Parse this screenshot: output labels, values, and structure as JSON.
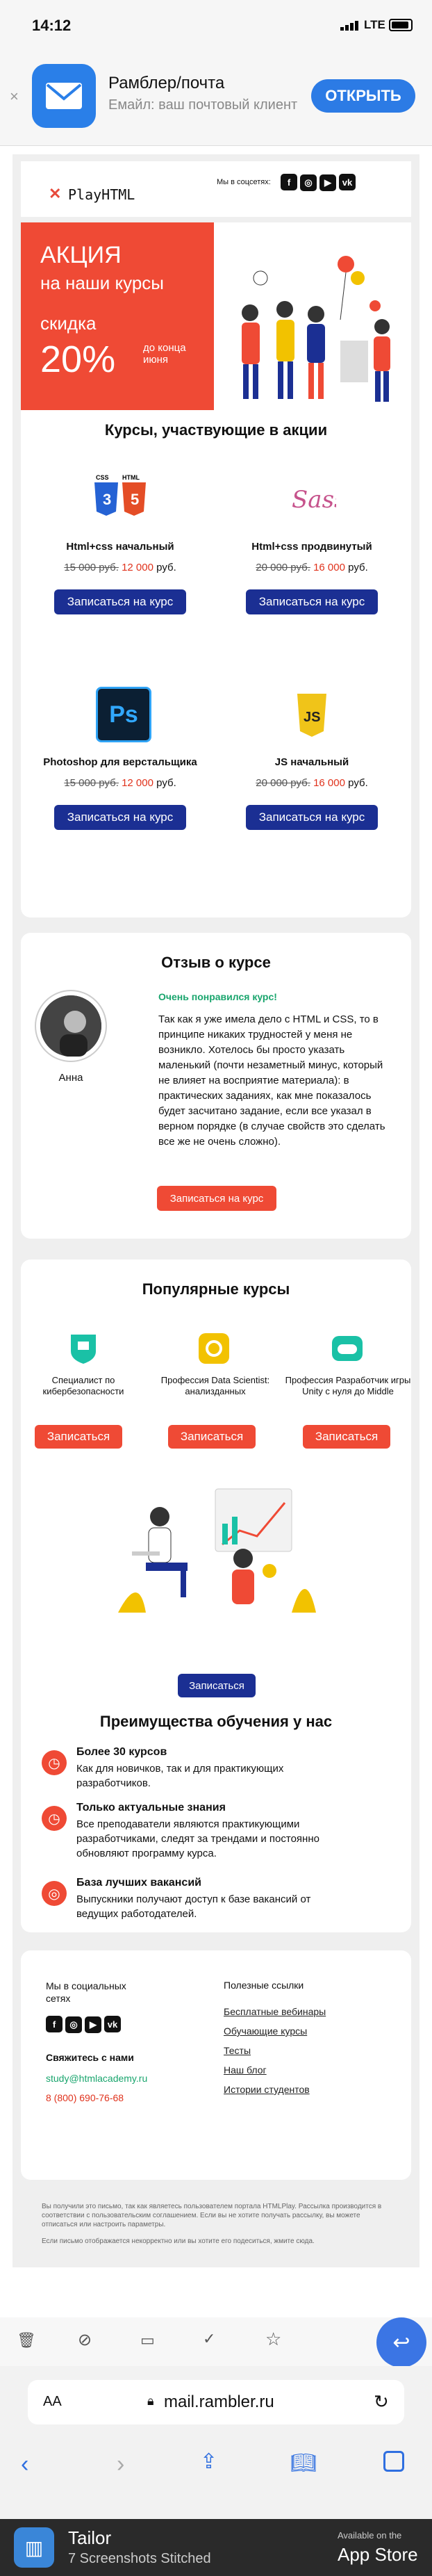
{
  "status": {
    "time": "14:12",
    "network": "LTE"
  },
  "banner": {
    "title": "Рамблер/почта",
    "subtitle": "Емайл: ваш почтовый клиент",
    "open_label": "ОТКРЫТЬ"
  },
  "email": {
    "logo": "PlayHTML",
    "social_label": "Мы в соцсетях:",
    "promo": {
      "line1": "АКЦИЯ",
      "line2": "на наши курсы",
      "discount_label": "скидка",
      "discount": "20%",
      "until": "до конца июня"
    },
    "courses_title": "Курсы, участвующие в акции",
    "courses": [
      {
        "name": "Html+css начальный",
        "old": "15 000 руб.",
        "new": "12 000",
        "cur": "руб.",
        "btn": "Записаться на курс"
      },
      {
        "name": "Html+css продвинутый",
        "old": "20 000 руб.",
        "new": "16 000",
        "cur": "руб.",
        "btn": "Записаться на курс"
      },
      {
        "name": "Photoshop для верстальщика",
        "old": "15 000 руб.",
        "new": "12 000",
        "cur": "руб.",
        "btn": "Записаться на курс"
      },
      {
        "name": "JS начальный",
        "old": "20 000 руб.",
        "new": "16 000",
        "cur": "руб.",
        "btn": "Записаться на курс"
      }
    ],
    "review": {
      "title": "Отзыв о курсе",
      "name": "Анна",
      "headline": "Очень понравился курс!",
      "text": "Так как я уже имела дело с HTML и CSS, то в принципе никаких трудностей у меня не возникло. Хотелось бы просто указать маленький (почти незаметный минус, который не влияет на восприятие материала): в практических заданиях, как мне показалось будет засчитано задание, если все указал в верном порядке (в случае свойств это сделать все же не очень сложно).",
      "btn": "Записаться на курс"
    },
    "popular": {
      "title": "Популярные курсы",
      "items": [
        {
          "name": "Специалист по кибербезопасности",
          "btn": "Записаться"
        },
        {
          "name": "Профессия Data Scientist: анализданных",
          "btn": "Записаться"
        },
        {
          "name": "Профессия Разработчик игры Unity с нуля до Middle",
          "btn": "Записаться"
        }
      ],
      "cta": "Записаться"
    },
    "advantages": {
      "title": "Преимущества обучения у нас",
      "items": [
        {
          "title": "Более 30 курсов",
          "text": "Как для новичков, так и для практикующих разработчиков."
        },
        {
          "title": "Только актуальные знания",
          "text": "Все преподаватели являются практикующими разработчиками, следят за трендами и постоянно обновляют программу курса."
        },
        {
          "title": "База лучших вакансий",
          "text": "Выпускники получают доступ к базе вакансий от ведущих работодателей."
        }
      ]
    },
    "footer": {
      "social_title": "Мы в социальных сетях",
      "contact_title": "Свяжитесь с нами",
      "email": "study@htmlacademy.ru",
      "phone": "8 (800) 690-76-68",
      "links_title": "Полезные ссылки",
      "links": [
        "Бесплатные вебинары",
        "Обучающие курсы",
        "Тесты",
        "Наш блог",
        "Истории студентов"
      ],
      "legal1": "Вы получили это письмо, так как являетесь пользователем портала HTMLPlay. Рассылка производится в соответствии с пользовательским соглашением. Если вы не хотите получать рассылку, вы можете отписаться или настроить параметры.",
      "legal2": "Если письмо отображается некорректно или вы хотите его подеситься, жмите сюда."
    }
  },
  "browser": {
    "aa": "AA",
    "url": "mail.rambler.ru"
  },
  "tailor": {
    "title": "Tailor",
    "subtitle": "7 Screenshots Stitched",
    "store_small": "Available on the",
    "store": "App Store"
  },
  "colors": {
    "red": "#ef4a35",
    "blue": "#1b2f93",
    "action": "#2f6fe0"
  }
}
